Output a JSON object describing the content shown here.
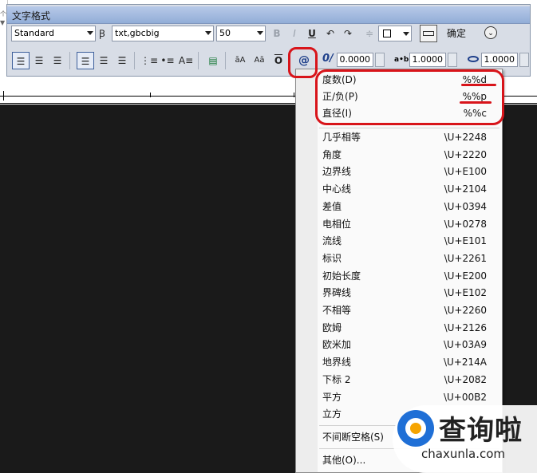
{
  "panel": {
    "title": "文字格式",
    "style_combo": "Standard",
    "font_combo": "txt,gbcbig",
    "height_combo": "50",
    "bold": "B",
    "italic": "I",
    "underline": "U",
    "overline_btn": "O",
    "ok_button": "确定",
    "oblique_value": "0.0000",
    "tracking_value": "1.0000",
    "width_value": "1.0000",
    "tracking_label": "a•b",
    "oblique_label": "0/",
    "upper_label": "āA",
    "lower_label": "Aā",
    "symbol_btn": "@"
  },
  "left_fragments": [
    "个",
    "▼"
  ],
  "menu": {
    "highlighted": [
      {
        "label": "度数(D)",
        "code": "%%d"
      },
      {
        "label": "正/负(P)",
        "code": "%%p"
      },
      {
        "label": "直径(I)",
        "code": "%%c"
      }
    ],
    "symbols": [
      {
        "label": "几乎相等",
        "code": "\\U+2248"
      },
      {
        "label": "角度",
        "code": "\\U+2220"
      },
      {
        "label": "边界线",
        "code": "\\U+E100"
      },
      {
        "label": "中心线",
        "code": "\\U+2104"
      },
      {
        "label": "差值",
        "code": "\\U+0394"
      },
      {
        "label": "电相位",
        "code": "\\U+0278"
      },
      {
        "label": "流线",
        "code": "\\U+E101"
      },
      {
        "label": "标识",
        "code": "\\U+2261"
      },
      {
        "label": "初始长度",
        "code": "\\U+E200"
      },
      {
        "label": "界碑线",
        "code": "\\U+E102"
      },
      {
        "label": "不相等",
        "code": "\\U+2260"
      },
      {
        "label": "欧姆",
        "code": "\\U+2126"
      },
      {
        "label": "欧米加",
        "code": "\\U+03A9"
      },
      {
        "label": "地界线",
        "code": "\\U+214A"
      },
      {
        "label": "下标 2",
        "code": "\\U+2082"
      },
      {
        "label": "平方",
        "code": "\\U+00B2"
      },
      {
        "label": "立方",
        "code": ""
      }
    ],
    "nbsp": "不间断空格(S)",
    "other": "其他(O)..."
  },
  "watermark": {
    "brand": "查询啦",
    "domain": "chaxunla.com",
    "q": "Q"
  },
  "colors": {
    "annotation_red": "#d8141a",
    "canvas": "#1a1a1a",
    "panel": "#d8dde6"
  }
}
